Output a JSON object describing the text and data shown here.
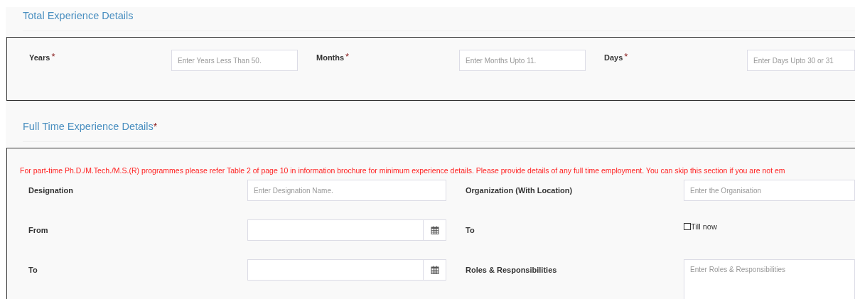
{
  "total_experience": {
    "title": "Total Experience Details",
    "fields": [
      {
        "label": "Years",
        "required_mark": "*",
        "placeholder": "Enter Years Less Than 50."
      },
      {
        "label": "Months",
        "required_mark": "*",
        "placeholder": "Enter Months Upto 11."
      },
      {
        "label": "Days",
        "required_mark": "*",
        "placeholder": "Enter Days Upto 30 or 31"
      }
    ]
  },
  "full_time_experience": {
    "title": "Full Time Experience Details",
    "required_mark": "*",
    "note": "For part-time Ph.D./M.Tech./M.S.(R) programmes please refer Table 2 of page 10 in information brochure for minimum experience details. Please provide details of any full time employment. You can skip this section if you are not em",
    "fields": [
      {
        "kind": "text",
        "label": "Designation",
        "placeholder": "Enter Designation Name."
      },
      {
        "kind": "text",
        "label": "Organization (With Location)",
        "placeholder": "Enter the Organisation"
      },
      {
        "kind": "date",
        "label": "From"
      },
      {
        "kind": "checkbox",
        "label": "To",
        "option": "Till now",
        "checked": false
      },
      {
        "kind": "date",
        "label": "To"
      },
      {
        "kind": "textarea",
        "label": "Roles & Responsibilities",
        "placeholder": "Enter Roles & Responsibilities"
      }
    ]
  }
}
